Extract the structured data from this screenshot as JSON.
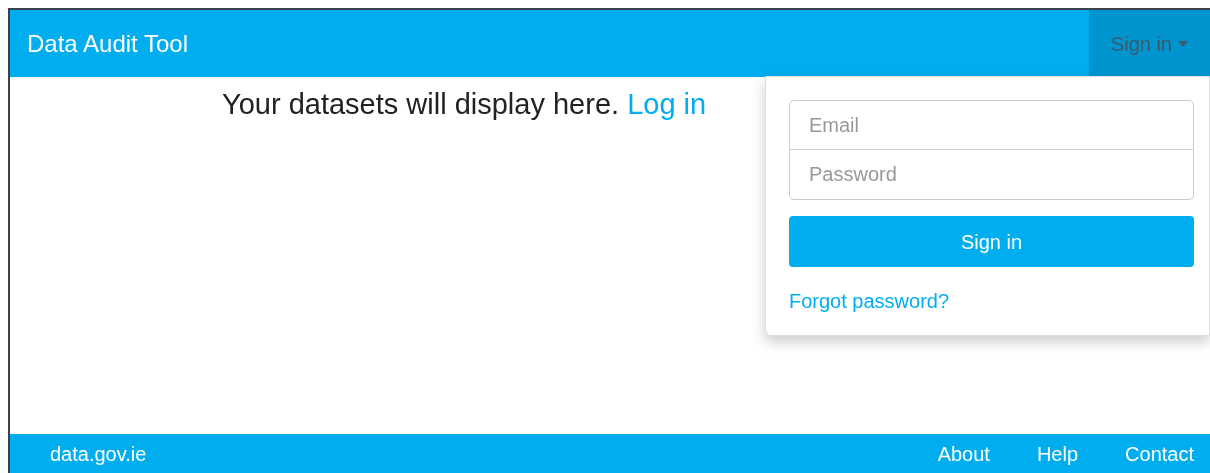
{
  "navbar": {
    "brand": "Data Audit Tool",
    "sign_in_toggle": {
      "label": "Sign in",
      "expanded": true
    }
  },
  "main": {
    "message": "Your datasets will display here.",
    "link": "Log in"
  },
  "sign_in_menu": {
    "email": {
      "placeholder": "Email"
    },
    "password": {
      "placeholder": "Password"
    },
    "submit": "Sign in",
    "forgot_link": "Forgot password?"
  },
  "footer": {
    "site": "data.gov.ie",
    "links": [
      "About",
      "Help",
      "Contact"
    ]
  }
}
